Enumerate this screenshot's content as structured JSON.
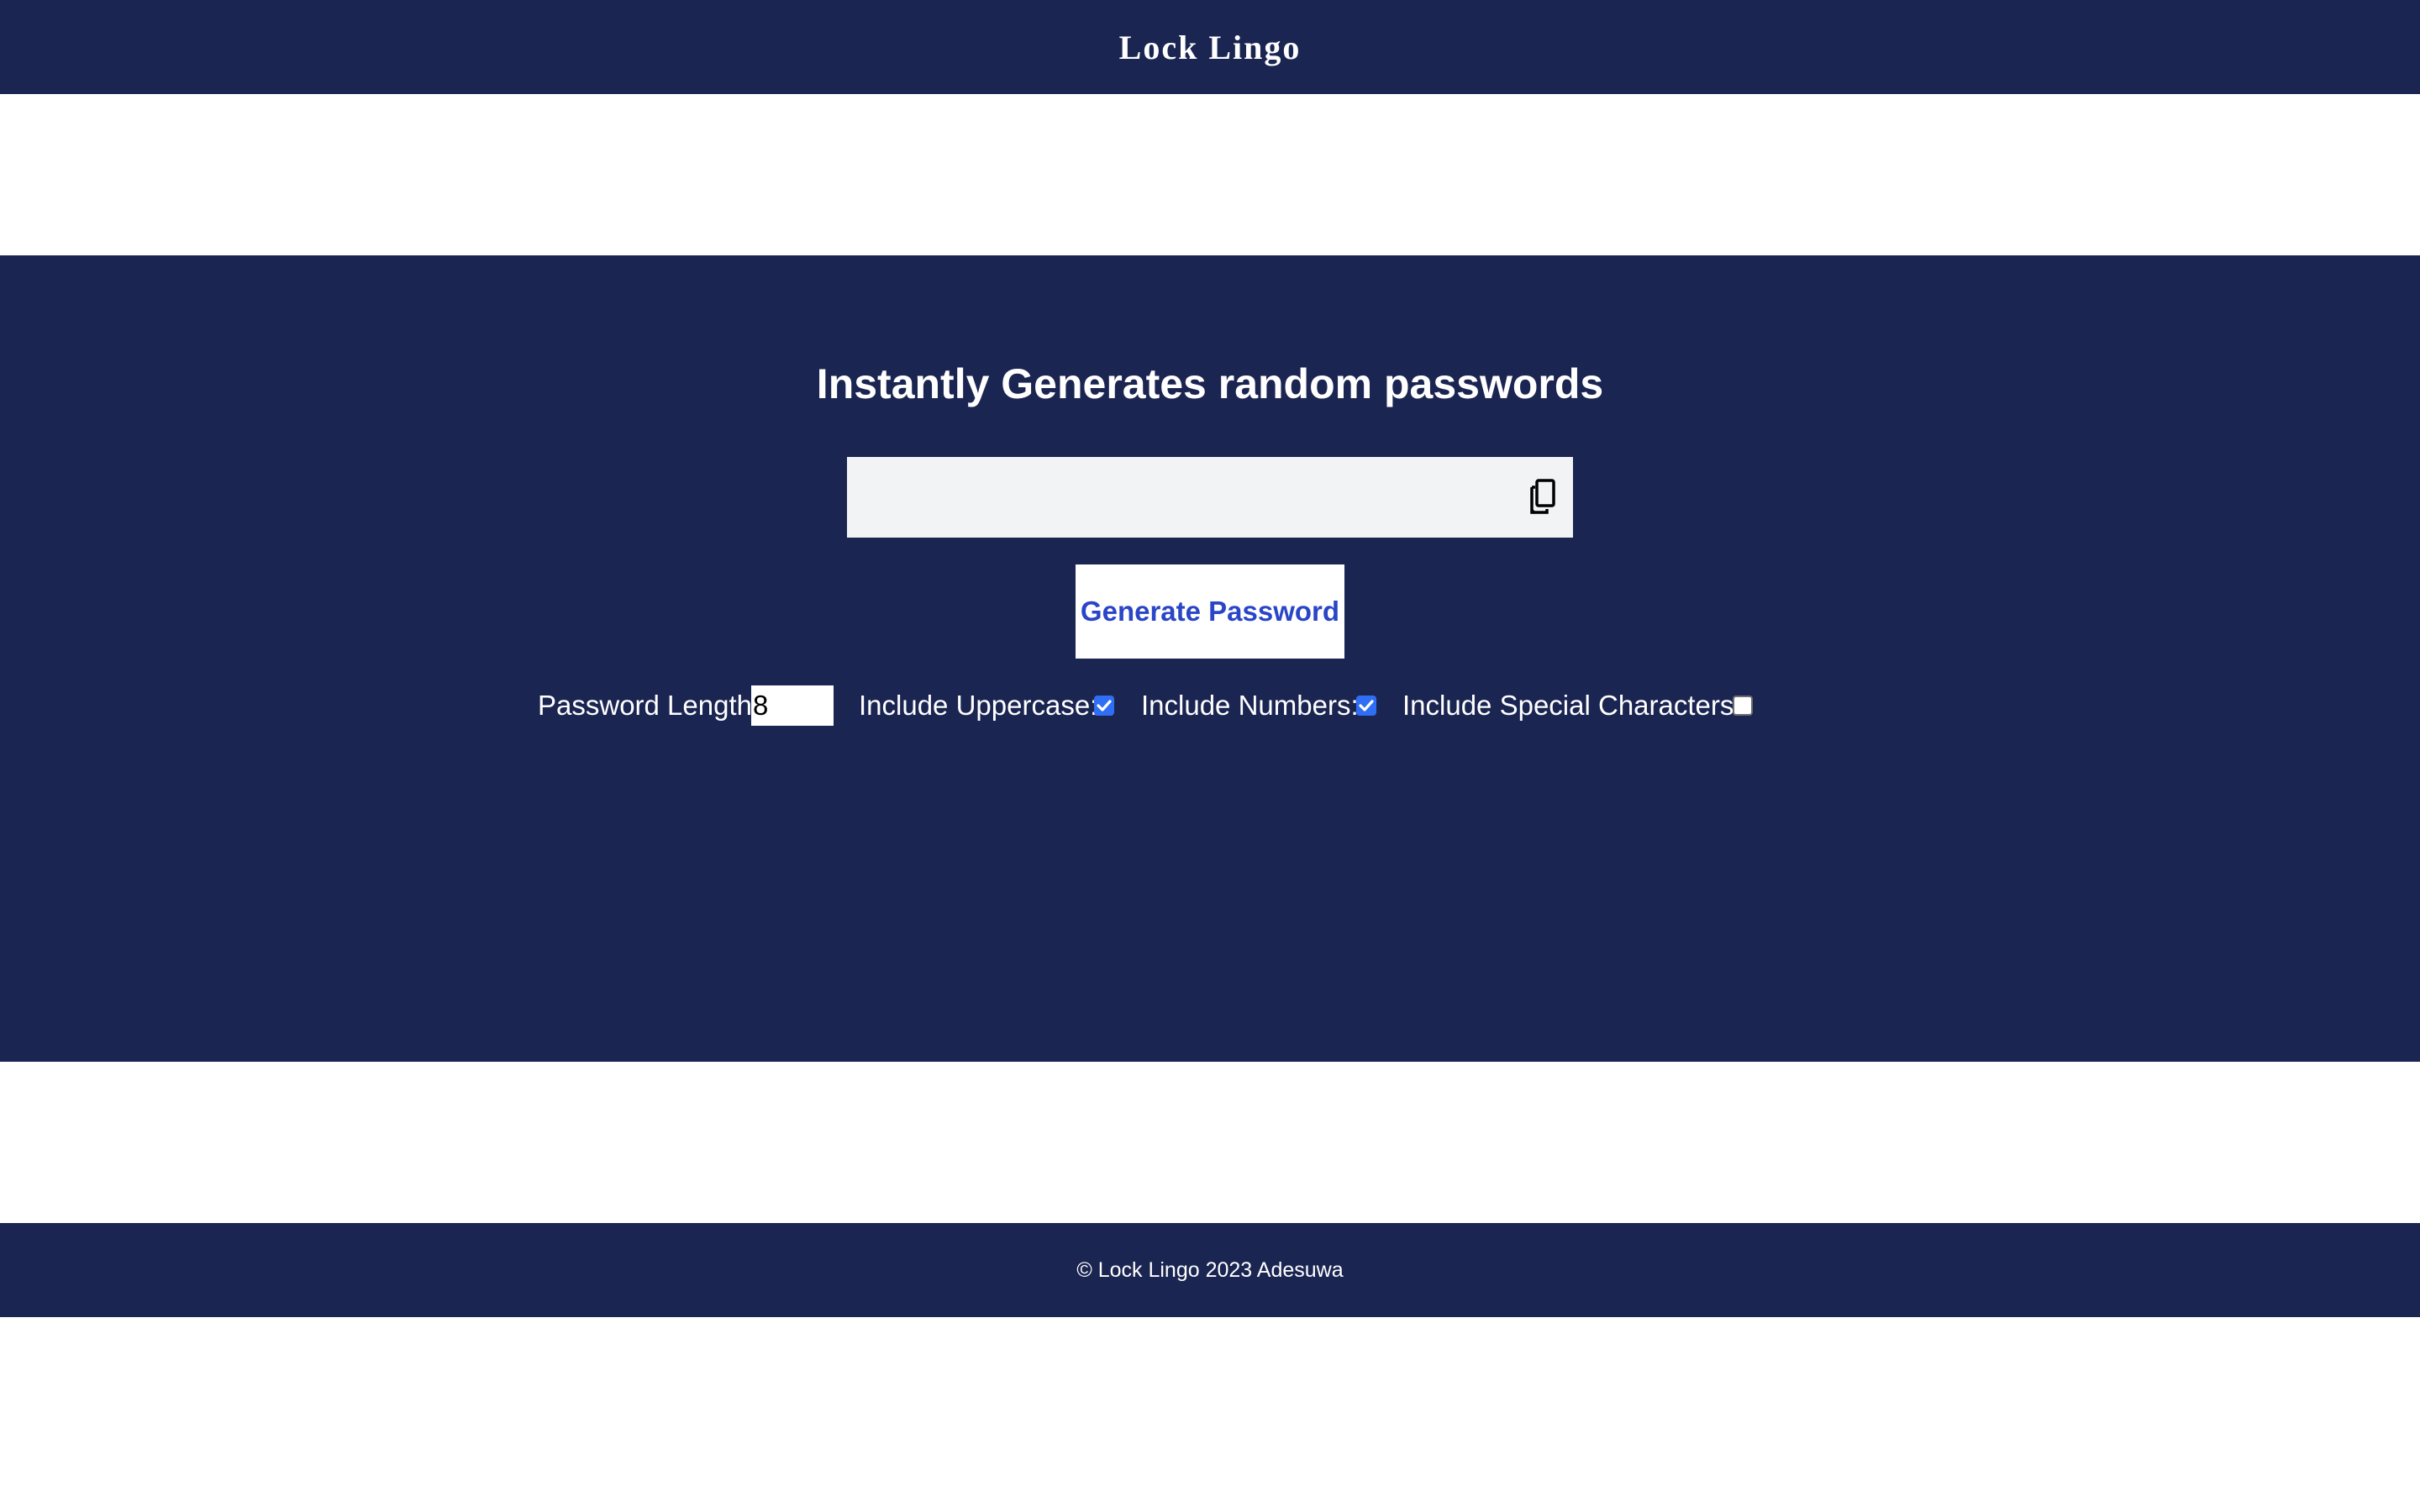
{
  "header": {
    "brand": "Lock Lingo"
  },
  "hero": {
    "title": "Instantly Generates random passwords",
    "password_value": "",
    "copy_icon": "copy-icon",
    "generate_label": "Generate Password"
  },
  "options": {
    "length_label": "Password Length:",
    "length_value": "8",
    "uppercase_label": "Include Uppercase:",
    "uppercase_checked": true,
    "numbers_label": "Include Numbers:",
    "numbers_checked": true,
    "special_label": "Include Special Characters:",
    "special_checked": false
  },
  "footer": {
    "text": "© Lock Lingo 2023 Adesuwa"
  },
  "colors": {
    "navy": "#1b2552",
    "button_text": "#2a45c6",
    "checkbox_accent": "#2f6ef5",
    "input_bg": "#f2f3f5"
  }
}
